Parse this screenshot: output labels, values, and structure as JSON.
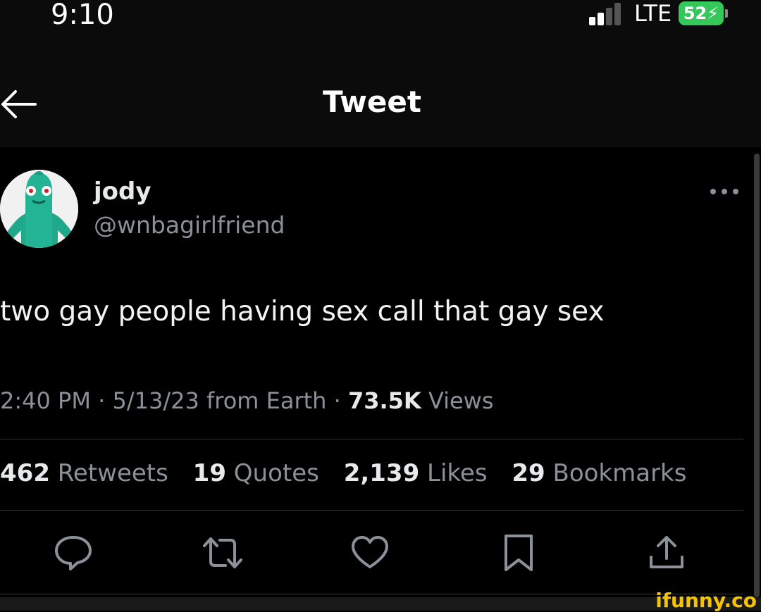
{
  "status_bar": {
    "time": "9:10",
    "network": "LTE",
    "battery": "52"
  },
  "nav": {
    "title": "Tweet",
    "back_icon": "arrow-left-icon"
  },
  "tweet": {
    "author_name": "jody",
    "author_handle": "@wnbagirlfriend",
    "text": "two gay people having sex call that gay sex",
    "time": "2:40 PM",
    "date": "5/13/23",
    "source": "from Earth",
    "views_count": "73.5K",
    "views_label": "Views",
    "separator": "·"
  },
  "stats": [
    {
      "count": "462",
      "label": "Retweets"
    },
    {
      "count": "19",
      "label": "Quotes"
    },
    {
      "count": "2,139",
      "label": "Likes"
    },
    {
      "count": "29",
      "label": "Bookmarks"
    }
  ],
  "actions": [
    "reply-icon",
    "retweet-icon",
    "like-icon",
    "bookmark-icon",
    "share-icon"
  ],
  "watermark": "ifunny.co",
  "colors": {
    "background": "#000000",
    "text": "#e7e9ea",
    "muted": "#8b9198",
    "battery": "#34c759",
    "watermark": "#f5c400"
  }
}
